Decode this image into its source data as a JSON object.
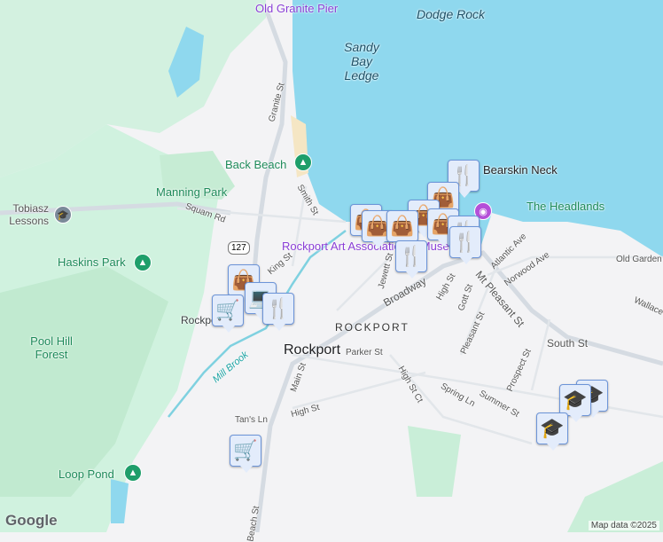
{
  "labels": {
    "parks": [
      "Back Beach",
      "Manning Park",
      "Haskins Park",
      "Pool Hill Forest",
      "The Headlands",
      "Loop Pond"
    ],
    "water": [
      "Dodge Rock",
      "Sandy Bay Ledge",
      "Mill Brook"
    ],
    "pois": [
      "Old Granite Pier",
      "Rockport Art Association & Museum",
      "Tobiasz Lessons",
      "Bearskin Neck"
    ],
    "town": "Rockport",
    "area": "ROCKPORT",
    "rail": "Rockport",
    "route": "127",
    "streets": [
      "Granite St",
      "Smith St",
      "Squam Rd",
      "King St",
      "Main St",
      "Jewett St",
      "Broadway",
      "High St",
      "Gott St",
      "Atlantic Ave",
      "Norwood Ave",
      "Mt Pleasant St",
      "Old Garden Rd",
      "Wallace",
      "Pleasant St",
      "South St",
      "Prospect St",
      "Parker St",
      "High St Ct",
      "Spring Ln",
      "Summer St",
      "High St",
      "Tan's Ln",
      "Main St",
      "Beach St"
    ]
  },
  "footer": {
    "logo": "Google",
    "attribution": "Map data ©2025"
  },
  "colors": {
    "water": "#8fd8ee",
    "land": "#f3f3f5",
    "park": "#c9eed8",
    "marker": "#e3ecfb",
    "marker_icon": "#0d3c61"
  }
}
